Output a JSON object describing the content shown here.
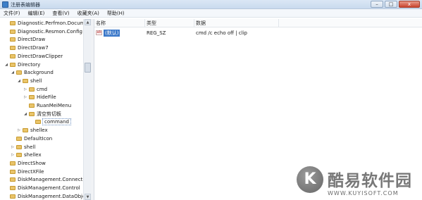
{
  "window": {
    "title": "注册表编辑器",
    "buttons": {
      "minimize": "–",
      "maximize": "□",
      "close": "x"
    }
  },
  "menu": [
    "文件(F)",
    "编辑(E)",
    "查看(V)",
    "收藏夹(A)",
    "帮助(H)"
  ],
  "tree": {
    "items": [
      {
        "label": "Diagnostic.Perfmon.Document",
        "level": 0,
        "expander": ""
      },
      {
        "label": "Diagnostic.Resmon.Config",
        "level": 0,
        "expander": ""
      },
      {
        "label": "DirectDraw",
        "level": 0,
        "expander": ""
      },
      {
        "label": "DirectDraw7",
        "level": 0,
        "expander": ""
      },
      {
        "label": "DirectDrawClipper",
        "level": 0,
        "expander": ""
      },
      {
        "label": "Directory",
        "level": 0,
        "expander": "◢"
      },
      {
        "label": "Background",
        "level": 1,
        "expander": "◢"
      },
      {
        "label": "shell",
        "level": 2,
        "expander": "◢"
      },
      {
        "label": "cmd",
        "level": 3,
        "expander": "▷"
      },
      {
        "label": "HideFile",
        "level": 3,
        "expander": "▷"
      },
      {
        "label": "RuanMeiMenu",
        "level": 3,
        "expander": ""
      },
      {
        "label": "清空剪切板",
        "level": 3,
        "expander": "◢"
      },
      {
        "label": "command",
        "level": 4,
        "expander": "",
        "selected": true
      },
      {
        "label": "shellex",
        "level": 2,
        "expander": "▷"
      },
      {
        "label": "DefaultIcon",
        "level": 1,
        "expander": ""
      },
      {
        "label": "shell",
        "level": 1,
        "expander": "▷"
      },
      {
        "label": "shellex",
        "level": 1,
        "expander": "▷"
      },
      {
        "label": "DirectShow",
        "level": 0,
        "expander": ""
      },
      {
        "label": "DirectXFile",
        "level": 0,
        "expander": ""
      },
      {
        "label": "DiskManagement.Connection",
        "level": 0,
        "expander": ""
      },
      {
        "label": "DiskManagement.Control",
        "level": 0,
        "expander": ""
      },
      {
        "label": "DiskManagement.DataObject",
        "level": 0,
        "expander": ""
      }
    ]
  },
  "values_pane": {
    "columns": [
      "名称",
      "类型",
      "数据"
    ],
    "rows": [
      {
        "name": "(默认)",
        "type": "REG_SZ",
        "data": "cmd /c echo off | clip",
        "icon": "ab"
      }
    ]
  },
  "watermark": {
    "logo_letter": "K",
    "brand": "酷易软件园",
    "url": "WWW.KUYISOFT.COM"
  },
  "colors": {
    "folder": "#e9c46a",
    "selection": "#3b78c9",
    "titlebar": "#c9daee"
  }
}
